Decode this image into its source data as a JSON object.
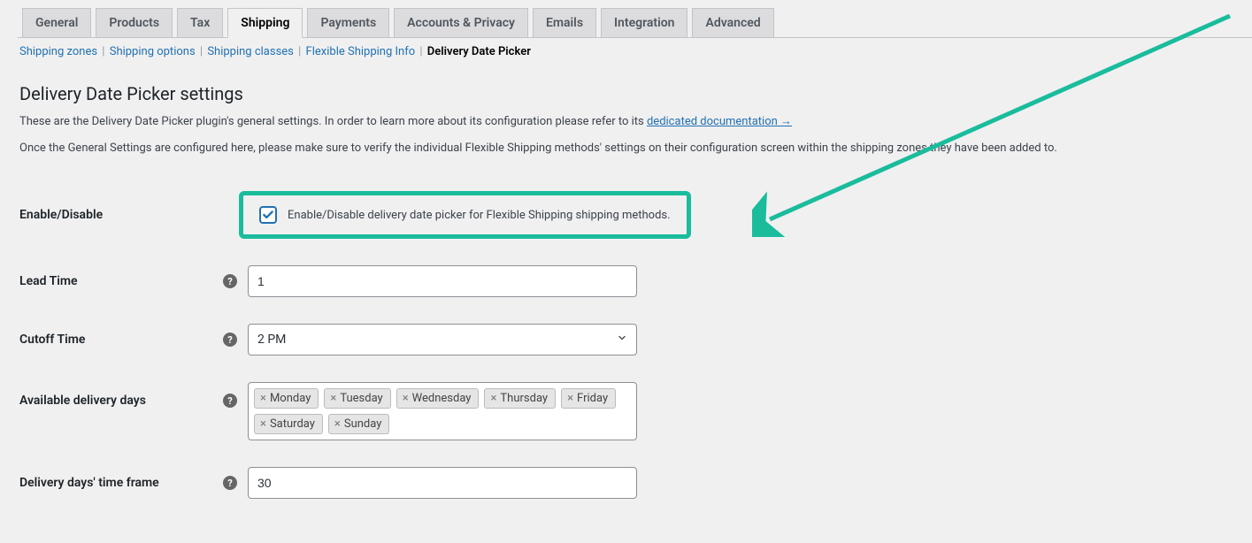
{
  "tabs": {
    "items": [
      {
        "label": "General",
        "active": false
      },
      {
        "label": "Products",
        "active": false
      },
      {
        "label": "Tax",
        "active": false
      },
      {
        "label": "Shipping",
        "active": true
      },
      {
        "label": "Payments",
        "active": false
      },
      {
        "label": "Accounts & Privacy",
        "active": false
      },
      {
        "label": "Emails",
        "active": false
      },
      {
        "label": "Integration",
        "active": false
      },
      {
        "label": "Advanced",
        "active": false
      }
    ]
  },
  "subnav": {
    "items": [
      {
        "label": "Shipping zones",
        "current": false
      },
      {
        "label": "Shipping options",
        "current": false
      },
      {
        "label": "Shipping classes",
        "current": false
      },
      {
        "label": "Flexible Shipping Info",
        "current": false
      },
      {
        "label": "Delivery Date Picker",
        "current": true
      }
    ]
  },
  "section": {
    "title": "Delivery Date Picker settings",
    "desc_prefix": "These are the Delivery Date Picker plugin's general settings. In order to learn more about its configuration please refer to its ",
    "doc_link_text": "dedicated documentation →",
    "desc2": "Once the General Settings are configured here, please make sure to verify the individual Flexible Shipping methods' settings on their configuration screen within the shipping zones they have been added to."
  },
  "fields": {
    "enable": {
      "label": "Enable/Disable",
      "checkbox_label": "Enable/Disable delivery date picker for Flexible Shipping shipping methods.",
      "checked": true
    },
    "lead_time": {
      "label": "Lead Time",
      "value": "1"
    },
    "cutoff": {
      "label": "Cutoff Time",
      "value": "2 PM"
    },
    "days": {
      "label": "Available delivery days",
      "items": [
        "Monday",
        "Tuesday",
        "Wednesday",
        "Thursday",
        "Friday",
        "Saturday",
        "Sunday"
      ]
    },
    "frame": {
      "label": "Delivery days' time frame",
      "value": "30"
    }
  },
  "colors": {
    "highlight": "#1abc9c",
    "link": "#2271b1"
  }
}
